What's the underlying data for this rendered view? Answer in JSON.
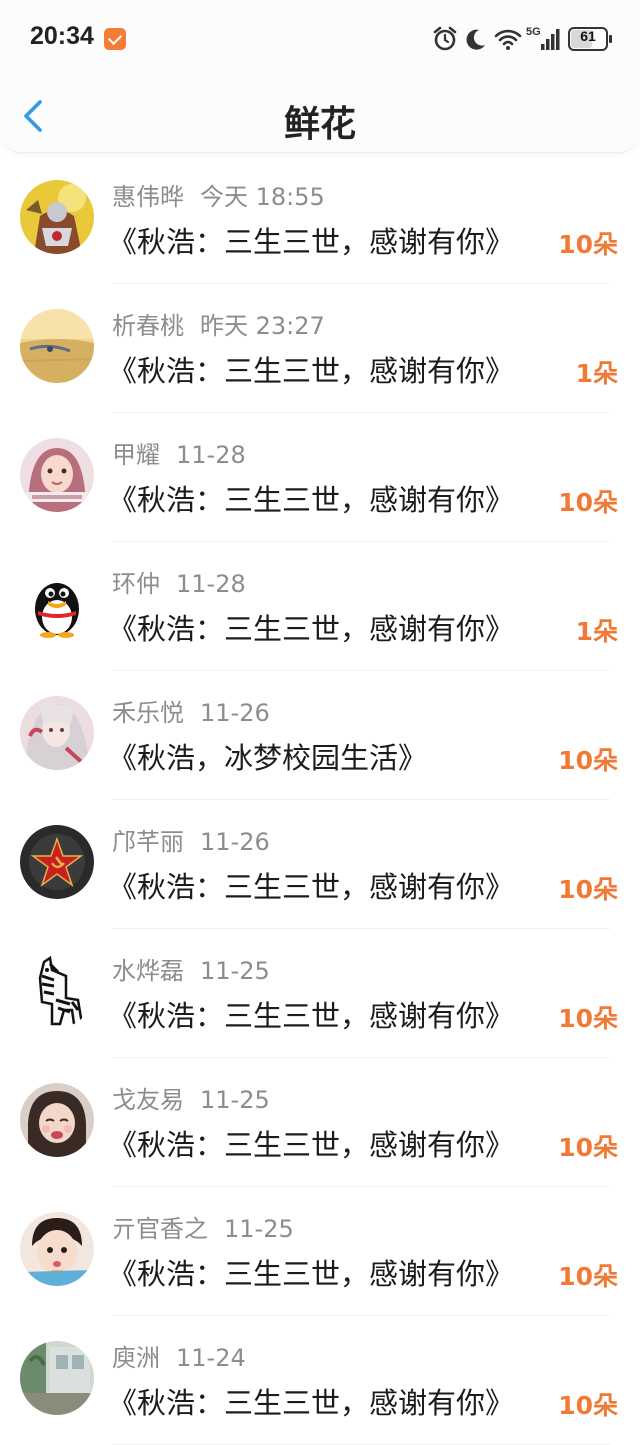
{
  "status_bar": {
    "time": "20:34",
    "network": "5G",
    "battery": "61"
  },
  "header": {
    "title": "鲜花"
  },
  "records": [
    {
      "name": "惠伟晔",
      "date": "今天 18:55",
      "book": "《秋浩：三生三世，感谢有你》",
      "count": "10朵",
      "avatar": "gold-armored-hero-avatar"
    },
    {
      "name": "析春桃",
      "date": "昨天 23:27",
      "book": "《秋浩：三生三世，感谢有你》",
      "count": "1朵",
      "avatar": "sunset-lake-avatar"
    },
    {
      "name": "甲耀",
      "date": "11-28",
      "book": "《秋浩：三生三世，感谢有你》",
      "count": "10朵",
      "avatar": "girl-portrait-avatar"
    },
    {
      "name": "环仲",
      "date": "11-28",
      "book": "《秋浩：三生三世，感谢有你》",
      "count": "1朵",
      "avatar": "penguin-avatar"
    },
    {
      "name": "禾乐悦",
      "date": "11-26",
      "book": "《秋浩，冰梦校园生活》",
      "count": "10朵",
      "avatar": "anime-character-avatar"
    },
    {
      "name": "邝芊丽",
      "date": "11-26",
      "book": "《秋浩：三生三世，感谢有你》",
      "count": "10朵",
      "avatar": "red-star-avatar"
    },
    {
      "name": "水烨磊",
      "date": "11-25",
      "book": "《秋浩：三生三世，感谢有你》",
      "count": "10朵",
      "avatar": "zebra-pinata-avatar"
    },
    {
      "name": "戈友易",
      "date": "11-25",
      "book": "《秋浩：三生三世，感谢有你》",
      "count": "10朵",
      "avatar": "child-portrait-avatar"
    },
    {
      "name": "亓官香之",
      "date": "11-25",
      "book": "《秋浩：三生三世，感谢有你》",
      "count": "10朵",
      "avatar": "toddler-portrait-avatar"
    },
    {
      "name": "庾洲",
      "date": "11-24",
      "book": "《秋浩：三生三世，感谢有你》",
      "count": "10朵",
      "avatar": "street-photo-avatar"
    }
  ],
  "colors": {
    "accent": "#f07a35",
    "name_text": "#8d8d8d",
    "book_text": "#1c1c1c",
    "back_icon": "#2e9be6"
  }
}
